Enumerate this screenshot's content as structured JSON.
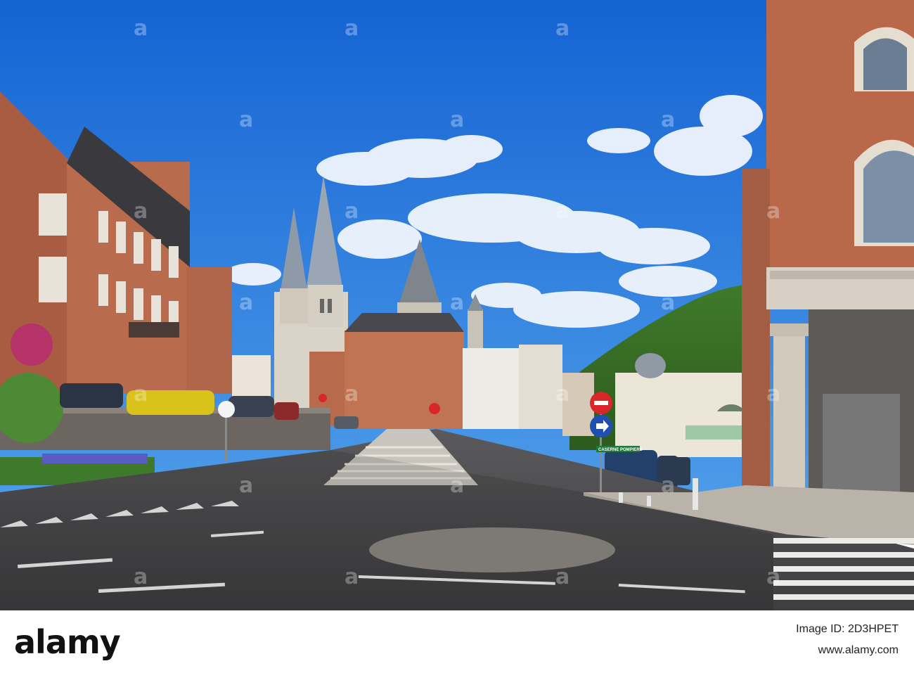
{
  "photo": {
    "alt_label": "",
    "street_sign_text": "CASERNE POMPIERS"
  },
  "footer": {
    "brand": "alamy",
    "image_id": "Image ID: 2D3HPET",
    "url": "www.alamy.com"
  },
  "watermark": {
    "letter": "a"
  },
  "colors": {
    "sky": "#1f6fd8",
    "brick": "#b5684c",
    "road": "#4a4a4c"
  }
}
